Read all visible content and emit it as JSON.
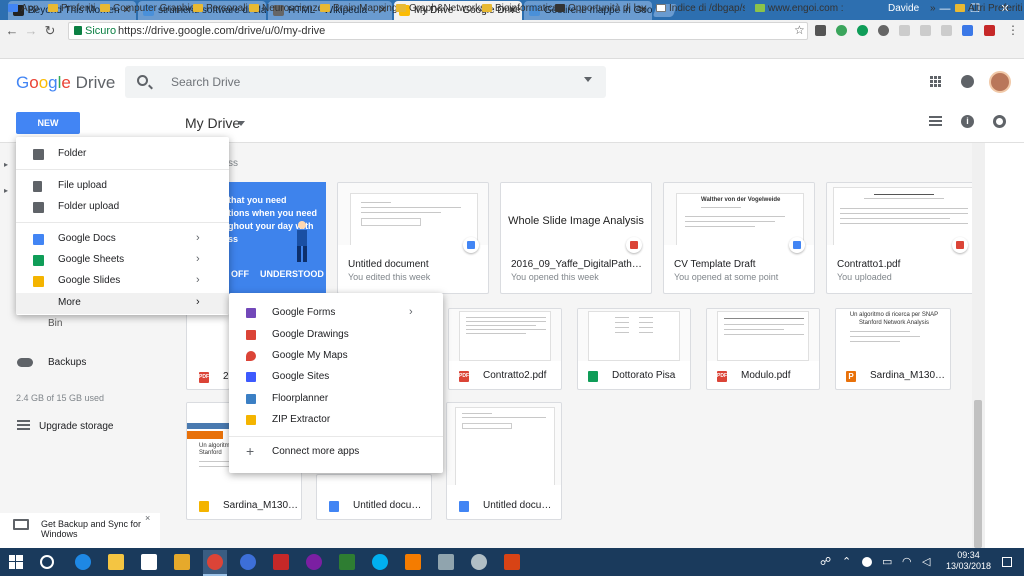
{
  "browser": {
    "tabs": [
      {
        "title": "Beyond This Momen",
        "icon_color": "#222222"
      },
      {
        "title": "strumenti software di ela",
        "icon_color": "#4a90d9"
      },
      {
        "title": "HTML - Wikipedia",
        "icon_color": "#666666"
      },
      {
        "title": "My Drive - Google Drive",
        "icon_color": "#fbbc05",
        "active": true
      },
      {
        "title": "Gestire le mappe in Goo",
        "icon_color": "#4a90d9"
      }
    ],
    "user": "Davide",
    "secure_label": "Sicuro",
    "url": "https://drive.google.com/drive/u/0/my-drive",
    "bookmarks": [
      "App",
      "Preferiti",
      "Computer Graphics",
      "Personali",
      "Neuroscienze",
      "Brain Mapping",
      "Graph&Networks",
      "Bioinformatics",
      "Opportunità di lavoro",
      "Indice di /dbgap/stu",
      "www.engoi.com : Fra",
      "»",
      "Altri Preferiti"
    ]
  },
  "drive": {
    "logo_google": "Google",
    "logo_drive": "Drive",
    "search_placeholder": "Search Drive",
    "new_button": "NEW",
    "location_title": "My Drive",
    "quick_access_fragment": "ss",
    "storage_text": "2.4 GB of 15 GB used",
    "sidebar_partial": "Bin",
    "backups_label": "Backups",
    "upgrade_label": "Upgrade storage",
    "backup_promo": "Get Backup and Sync for Windows",
    "backup_close": "×"
  },
  "new_menu": {
    "items": [
      {
        "label": "Folder",
        "icon": "folder-plus-icon",
        "color": "#5f6368"
      },
      {
        "label": "File upload",
        "icon": "file-upload-icon",
        "color": "#5f6368"
      },
      {
        "label": "Folder upload",
        "icon": "folder-upload-icon",
        "color": "#5f6368"
      },
      {
        "label": "Google Docs",
        "icon": "google-docs-icon",
        "color": "#4285f4",
        "arrow": "›"
      },
      {
        "label": "Google Sheets",
        "icon": "google-sheets-icon",
        "color": "#0f9d58",
        "arrow": "›"
      },
      {
        "label": "Google Slides",
        "icon": "google-slides-icon",
        "color": "#f4b400",
        "arrow": "›"
      },
      {
        "label": "More",
        "icon": "",
        "color": "",
        "arrow": "›"
      }
    ]
  },
  "more_menu": {
    "items": [
      {
        "label": "Google Forms",
        "icon": "google-forms-icon",
        "color": "#7248b9",
        "arrow": "›"
      },
      {
        "label": "Google Drawings",
        "icon": "google-drawings-icon",
        "color": "#db4437"
      },
      {
        "label": "Google My Maps",
        "icon": "google-my-maps-icon",
        "color": "#db4437"
      },
      {
        "label": "Google Sites",
        "icon": "google-sites-icon",
        "color": "#3d5afe"
      },
      {
        "label": "Floorplanner",
        "icon": "floorplanner-icon",
        "color": "#3b7fc4"
      },
      {
        "label": "ZIP Extractor",
        "icon": "zip-extractor-icon",
        "color": "#f4b400"
      },
      {
        "label": "Connect more apps",
        "icon": "plus-icon",
        "color": "#5f6368"
      }
    ]
  },
  "promo_card": {
    "text": "that you need\ntions when you need\nghout your day with\nss",
    "off": "OFF",
    "understood": "UNDERSTOOD"
  },
  "quick_access": [
    {
      "title": "Untitled document",
      "subtitle": "You edited this week",
      "badge_color": "#4285f4"
    },
    {
      "title": "2016_09_Yaffe_DigitalPathology....",
      "subtitle": "You opened this week",
      "badge_color": "#db4437",
      "thumb_text": "Whole Slide Image Analysis"
    },
    {
      "title": "CV Template Draft",
      "subtitle": "You opened at some point",
      "badge_color": "#4285f4",
      "thumb_text": "Walther von der Vogelweide"
    },
    {
      "title": "Contratto1.pdf",
      "subtitle": "You uploaded",
      "badge_color": "#db4437"
    }
  ],
  "files": [
    {
      "title": "2",
      "icon_color": "#db4437",
      "icon_text": "PDF"
    },
    {
      "title": "Contratto2.pdf",
      "icon_color": "#db4437",
      "icon_text": "PDF"
    },
    {
      "title": "Dottorato Pisa",
      "icon_color": "#0f9d58",
      "icon_text": ""
    },
    {
      "title": "Modulo.pdf",
      "icon_color": "#db4437",
      "icon_text": "PDF"
    },
    {
      "title": "Sardina_M1300...",
      "icon_color": "#e8710a",
      "icon_text": "P",
      "thumb_text": "Un algoritmo di ricerca per SNAP Stanford Network Analysis"
    },
    {
      "title": "Sardina_M1300...",
      "icon_color": "#f4b400",
      "icon_text": "",
      "thumb_text": "Un algoritm Stanford"
    },
    {
      "title": "Untitled docume...",
      "icon_color": "#4285f4",
      "icon_text": ""
    },
    {
      "title": "Untitled docume...",
      "icon_color": "#4285f4",
      "icon_text": ""
    }
  ],
  "taskbar": {
    "time": "09:34",
    "date": "13/03/2018"
  }
}
